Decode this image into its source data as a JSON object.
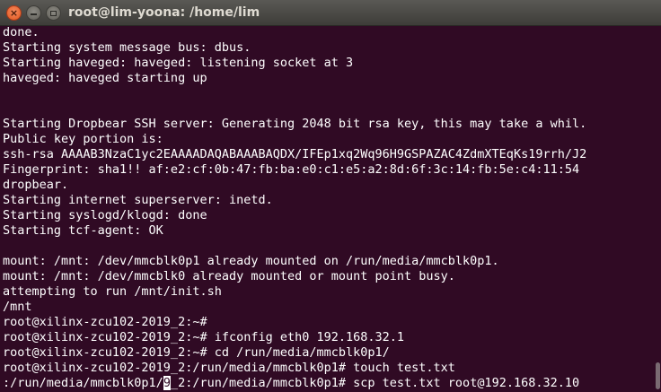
{
  "window": {
    "title": "root@lim-yoona: /home/lim",
    "close_glyph": "×",
    "min_icon": "minimize-icon",
    "max_icon": "maximize-icon"
  },
  "terminal": {
    "lines": [
      "done.",
      "Starting system message bus: dbus.",
      "Starting haveged: haveged: listening socket at 3",
      "haveged: haveged starting up",
      "",
      "",
      "Starting Dropbear SSH server: Generating 2048 bit rsa key, this may take a whil.",
      "Public key portion is:",
      "ssh-rsa AAAAB3NzaC1yc2EAAAADAQABAAABAQDX/IFEp1xq2Wq96H9GSPAZAC4ZdmXTEqKs19rrh/J2",
      "Fingerprint: sha1!! af:e2:cf:0b:47:fb:ba:e0:c1:e5:a2:8d:6f:3c:14:fb:5e:c4:11:54",
      "dropbear.",
      "Starting internet superserver: inetd.",
      "Starting syslogd/klogd: done",
      "Starting tcf-agent: OK",
      "",
      "mount: /mnt: /dev/mmcblk0p1 already mounted on /run/media/mmcblk0p1.",
      "mount: /mnt: /dev/mmcblk0 already mounted or mount point busy.",
      "attempting to run /mnt/init.sh",
      "/mnt",
      "root@xilinx-zcu102-2019_2:~#",
      "root@xilinx-zcu102-2019_2:~# ifconfig eth0 192.168.32.1",
      "root@xilinx-zcu102-2019_2:~# cd /run/media/mmcblk0p1/",
      "root@xilinx-zcu102-2019_2:/run/media/mmcblk0p1# touch test.txt"
    ],
    "last_line_before_cursor": ":/run/media/mmcblk0p1/",
    "cursor_char": "9",
    "last_line_after_cursor": "_2:/run/media/mmcblk0p1# scp test.txt root@192.168.32.10"
  }
}
